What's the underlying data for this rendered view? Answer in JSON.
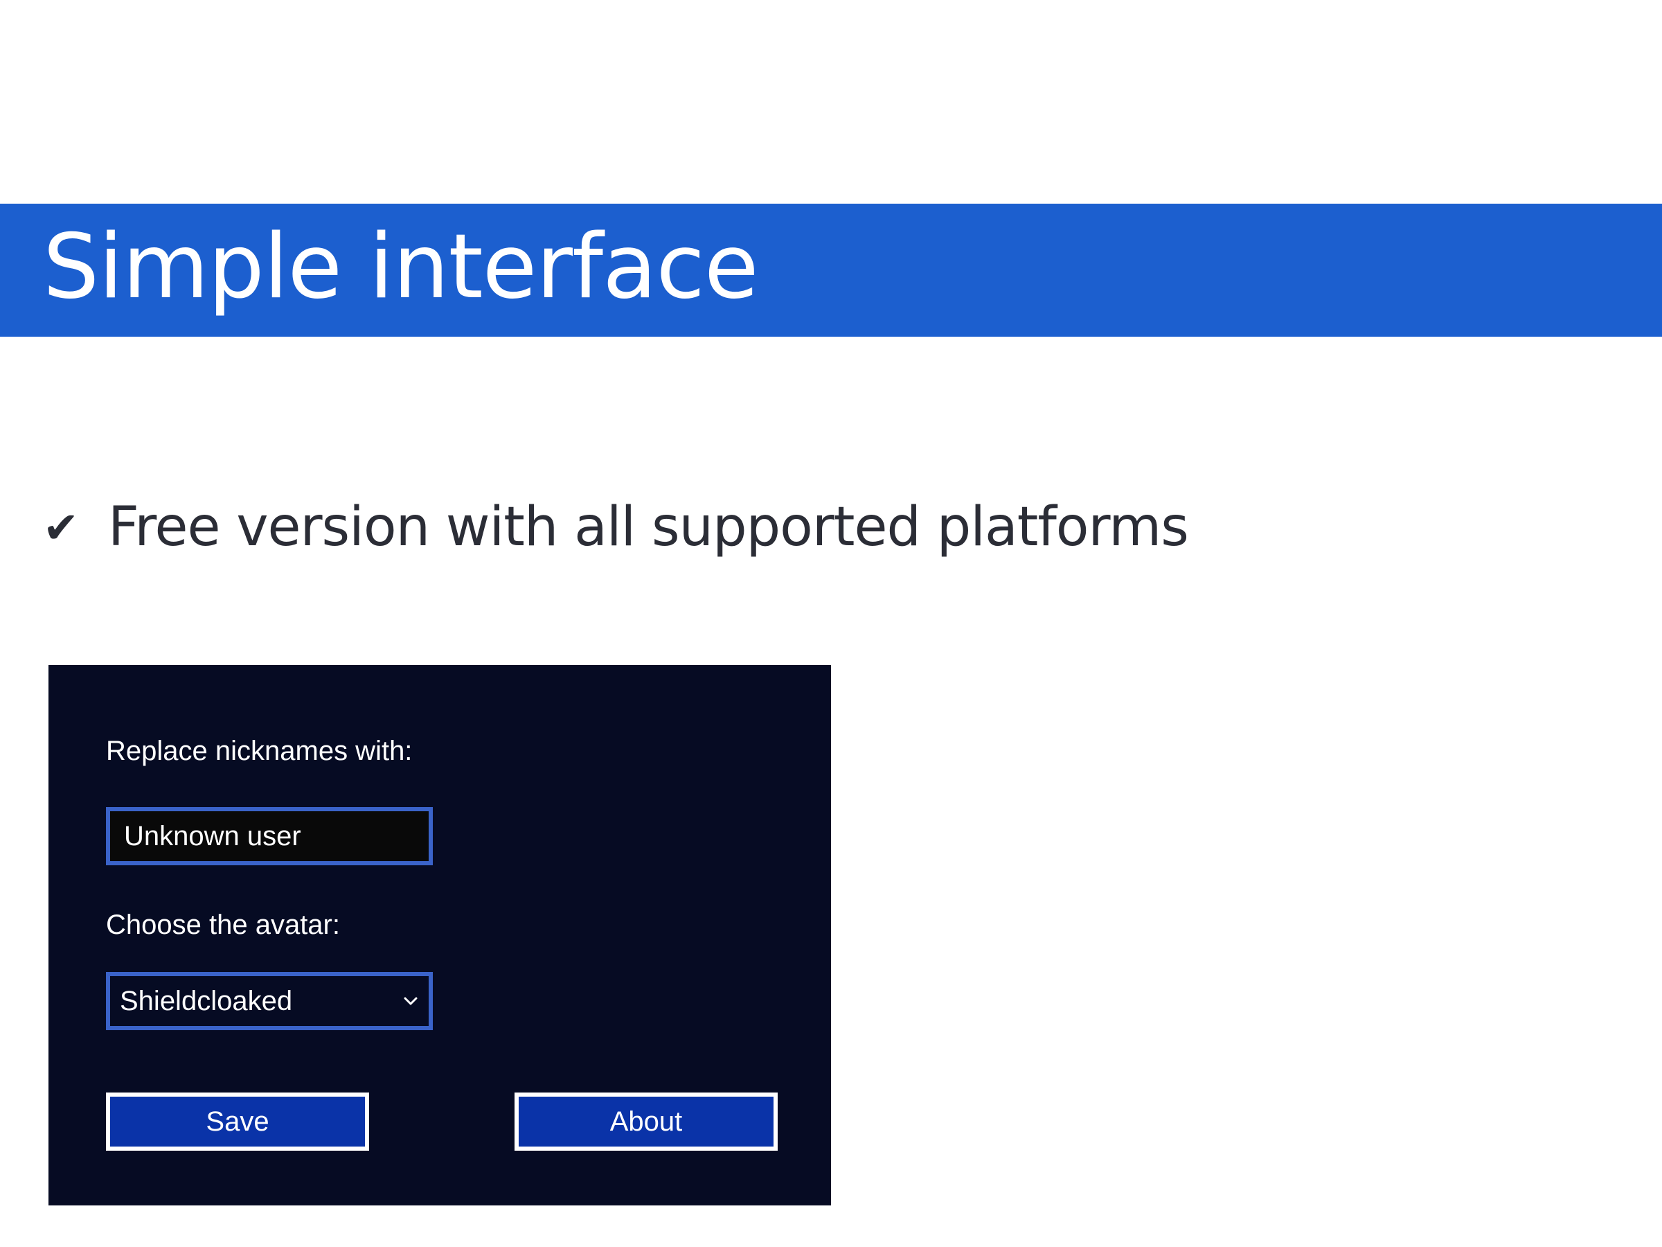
{
  "slide": {
    "title": "Simple interface",
    "bullet": {
      "icon": "check-icon",
      "text": "Free version with all supported platforms"
    }
  },
  "settings_panel": {
    "nickname_label": "Replace nicknames with:",
    "nickname_value": "Unknown user",
    "avatar_label": "Choose the avatar:",
    "avatar_selected": "Shieldcloaked",
    "save_label": "Save",
    "about_label": "About"
  },
  "colors": {
    "title_band": "#1c5fcf",
    "panel_background": "#060b23",
    "field_border": "#3a63c9",
    "button_fill": "#0a33a8"
  }
}
